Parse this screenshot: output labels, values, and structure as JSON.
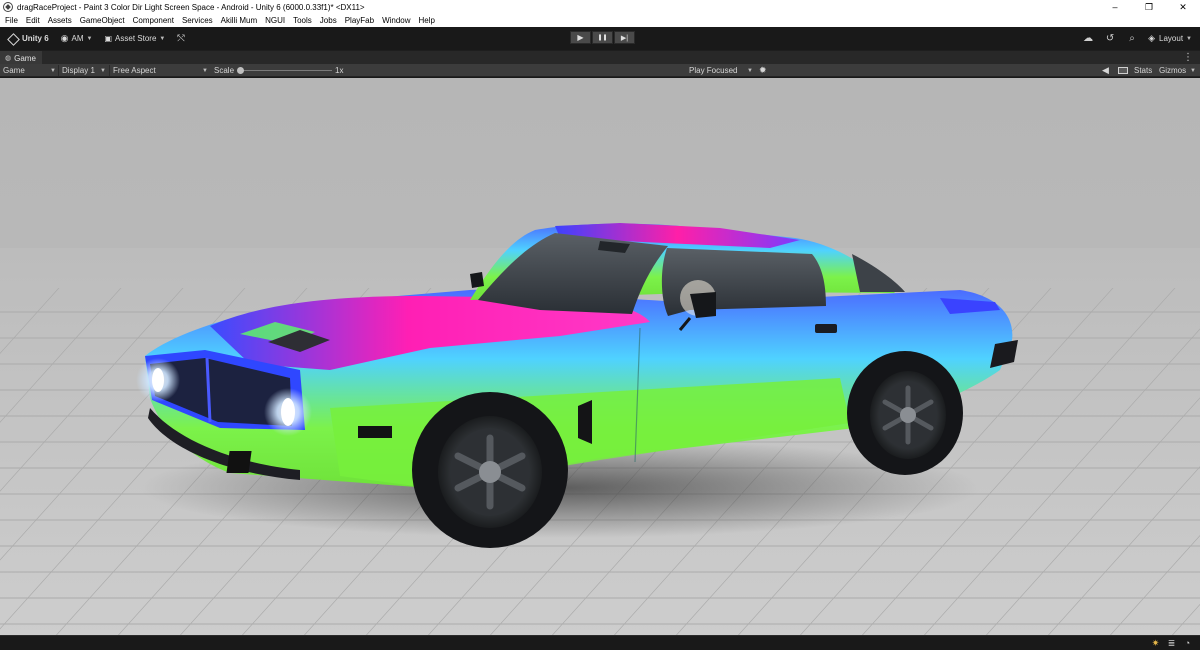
{
  "window": {
    "title": "dragRaceProject - Paint 3 Color Dir Light Screen Space - Android - Unity 6 (6000.0.33f1)* <DX11>",
    "controls": {
      "minimize": "–",
      "restore": "❐",
      "close": "✕"
    }
  },
  "menubar": {
    "items": [
      "File",
      "Edit",
      "Assets",
      "GameObject",
      "Component",
      "Services",
      "Akilli Mum",
      "NGUI",
      "Tools",
      "Jobs",
      "PlayFab",
      "Window",
      "Help"
    ]
  },
  "toolbar": {
    "unity_label": "Unity 6",
    "account_label": "AM",
    "asset_store_label": "Asset Store",
    "layout_label": "Layout",
    "icons": [
      "cloud-icon",
      "history-icon",
      "search-icon"
    ]
  },
  "playmode": {
    "play": "▶",
    "pause": "❚❚",
    "step": "▶|"
  },
  "tab": {
    "label": "Game",
    "menu_glyph": "⋮"
  },
  "gameview": {
    "view_label": "Game",
    "display_label": "Display 1",
    "aspect_label": "Free Aspect",
    "scale_label": "Scale",
    "scale_value": "1x",
    "play_mode_label": "Play Focused",
    "stats_label": "Stats",
    "gizmos_label": "Gizmos"
  },
  "colors": {
    "editor_bg": "#191919",
    "toolbar_bg": "#3c3c3c",
    "paint_magenta": "#ff1fb4",
    "paint_blue": "#2f4cff",
    "paint_cyan": "#52d6ff",
    "paint_green": "#7cff3a"
  }
}
